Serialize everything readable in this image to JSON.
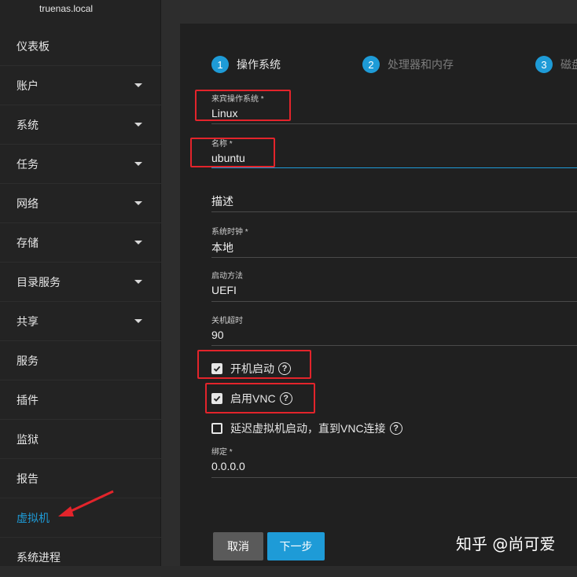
{
  "sidebar": {
    "hostname": "truenas.local",
    "items": [
      {
        "label": "仪表板",
        "has_arrow": false
      },
      {
        "label": "账户",
        "has_arrow": true
      },
      {
        "label": "系统",
        "has_arrow": true
      },
      {
        "label": "任务",
        "has_arrow": true
      },
      {
        "label": "网络",
        "has_arrow": true
      },
      {
        "label": "存储",
        "has_arrow": true
      },
      {
        "label": "目录服务",
        "has_arrow": true
      },
      {
        "label": "共享",
        "has_arrow": true
      },
      {
        "label": "服务",
        "has_arrow": false
      },
      {
        "label": "插件",
        "has_arrow": false
      },
      {
        "label": "监狱",
        "has_arrow": false
      },
      {
        "label": "报告",
        "has_arrow": false
      },
      {
        "label": "虚拟机",
        "has_arrow": false,
        "active": true
      },
      {
        "label": "系统进程",
        "has_arrow": false
      }
    ]
  },
  "wizard": {
    "steps": [
      {
        "number": "1",
        "label": "操作系统"
      },
      {
        "number": "2",
        "label": "处理器和内存"
      },
      {
        "number": "3",
        "label": "磁盘"
      }
    ],
    "fields": {
      "guest_os": {
        "label": "来宾操作系统 *",
        "value": "Linux"
      },
      "name": {
        "label": "名称 *",
        "value": "ubuntu"
      },
      "description": {
        "label": "",
        "value": "描述"
      },
      "system_clock": {
        "label": "系统时钟 *",
        "value": "本地"
      },
      "boot_method": {
        "label": "启动方法",
        "value": "UEFI"
      },
      "shutdown_timeout": {
        "label": "关机超时",
        "value": "90"
      },
      "bind": {
        "label": "绑定 *",
        "value": "0.0.0.0"
      }
    },
    "checkboxes": {
      "autostart": {
        "label": "开机启动",
        "checked": true
      },
      "enable_vnc": {
        "label": "启用VNC",
        "checked": true
      },
      "delay_vm_boot": {
        "label": "延迟虚拟机启动，直到VNC连接",
        "checked": false
      }
    },
    "buttons": {
      "cancel": "取消",
      "next": "下一步"
    }
  },
  "watermark": "知乎 @尚可爱",
  "colors": {
    "accent": "#1e9bd7",
    "annotation": "#e3242b",
    "sidebar_bg": "#232323",
    "card_bg": "#202020"
  }
}
